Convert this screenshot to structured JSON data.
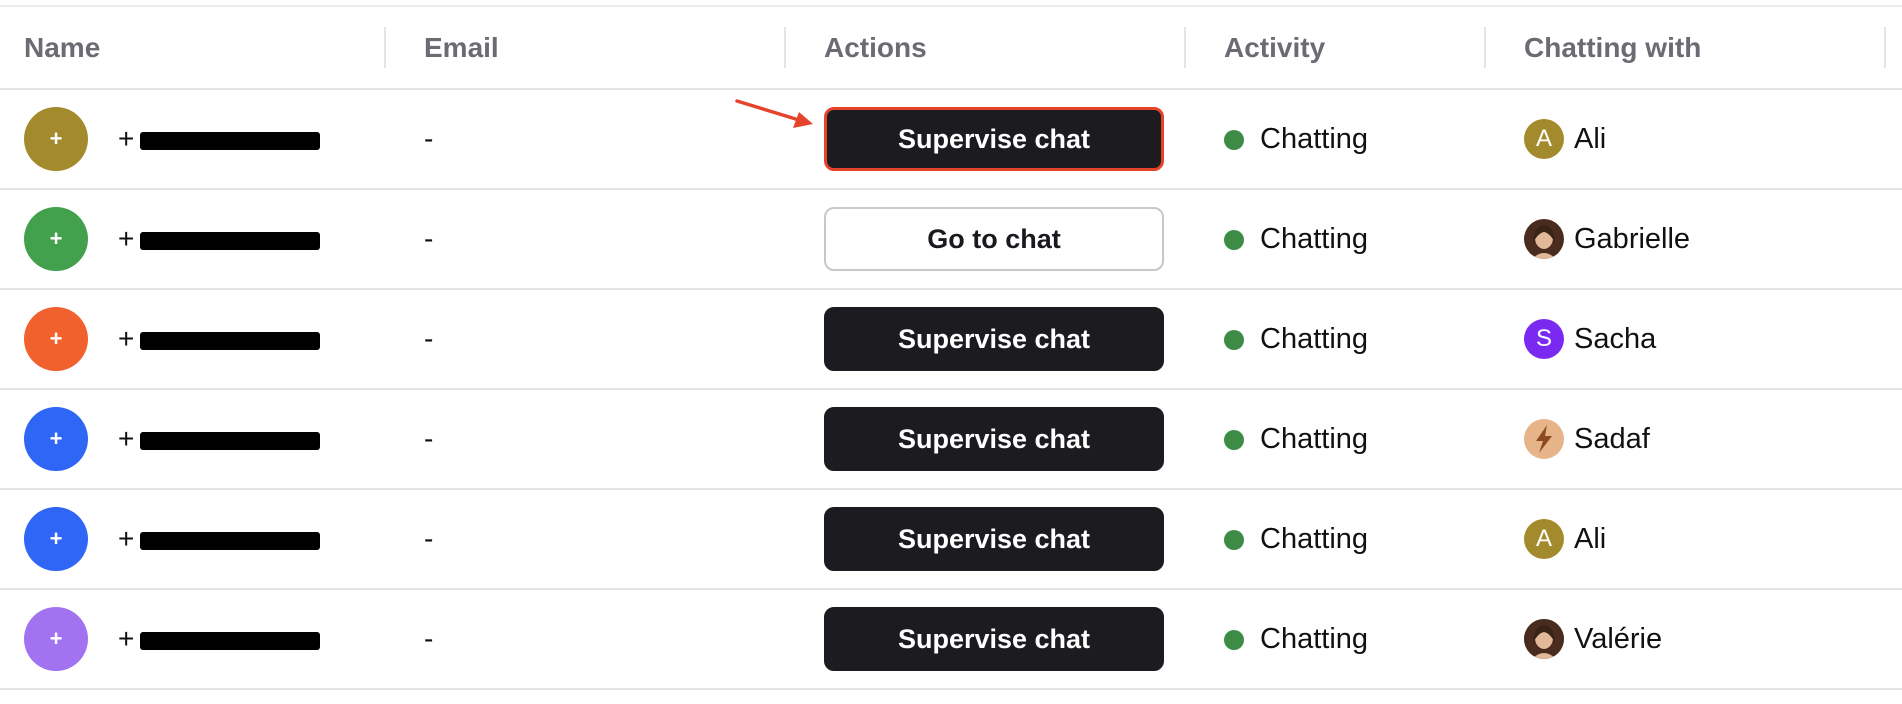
{
  "columns": {
    "name": "Name",
    "email": "Email",
    "actions": "Actions",
    "activity": "Activity",
    "chatting_with": "Chatting with"
  },
  "colors": {
    "row_avatars": [
      "#a38b2d",
      "#43a04d",
      "#f0612d",
      "#2f66f6",
      "#2f66f6",
      "#a273f1"
    ],
    "status_dot": "#3d8c46",
    "primary_button": "#1c1c20",
    "highlight": "#e5442b"
  },
  "rows": [
    {
      "avatar": "+",
      "name_prefix": "+",
      "email": "-",
      "action": "Supervise chat",
      "action_style": "dark",
      "highlighted": true,
      "activity": "Chatting",
      "agent": {
        "name": "Ali",
        "initial": "A",
        "avatar_color": "#a38b2d",
        "avatar_type": "initial"
      }
    },
    {
      "avatar": "+",
      "name_prefix": "+",
      "email": "-",
      "action": "Go to chat",
      "action_style": "light",
      "highlighted": false,
      "activity": "Chatting",
      "agent": {
        "name": "Gabrielle",
        "initial": "",
        "avatar_color": "#b07a5c",
        "avatar_type": "photo"
      }
    },
    {
      "avatar": "+",
      "name_prefix": "+",
      "email": "-",
      "action": "Supervise chat",
      "action_style": "dark",
      "highlighted": false,
      "activity": "Chatting",
      "agent": {
        "name": "Sacha",
        "initial": "S",
        "avatar_color": "#7a2af0",
        "avatar_type": "initial"
      }
    },
    {
      "avatar": "+",
      "name_prefix": "+",
      "email": "-",
      "action": "Supervise chat",
      "action_style": "dark",
      "highlighted": false,
      "activity": "Chatting",
      "agent": {
        "name": "Sadaf",
        "initial": "",
        "avatar_color": "#e7b48a",
        "avatar_type": "lightning-icon"
      }
    },
    {
      "avatar": "+",
      "name_prefix": "+",
      "email": "-",
      "action": "Supervise chat",
      "action_style": "dark",
      "highlighted": false,
      "activity": "Chatting",
      "agent": {
        "name": "Ali",
        "initial": "A",
        "avatar_color": "#a38b2d",
        "avatar_type": "initial"
      }
    },
    {
      "avatar": "+",
      "name_prefix": "+",
      "email": "-",
      "action": "Supervise chat",
      "action_style": "dark",
      "highlighted": false,
      "activity": "Chatting",
      "agent": {
        "name": "Valérie",
        "initial": "",
        "avatar_color": "#3a2a22",
        "avatar_type": "photo"
      }
    }
  ]
}
